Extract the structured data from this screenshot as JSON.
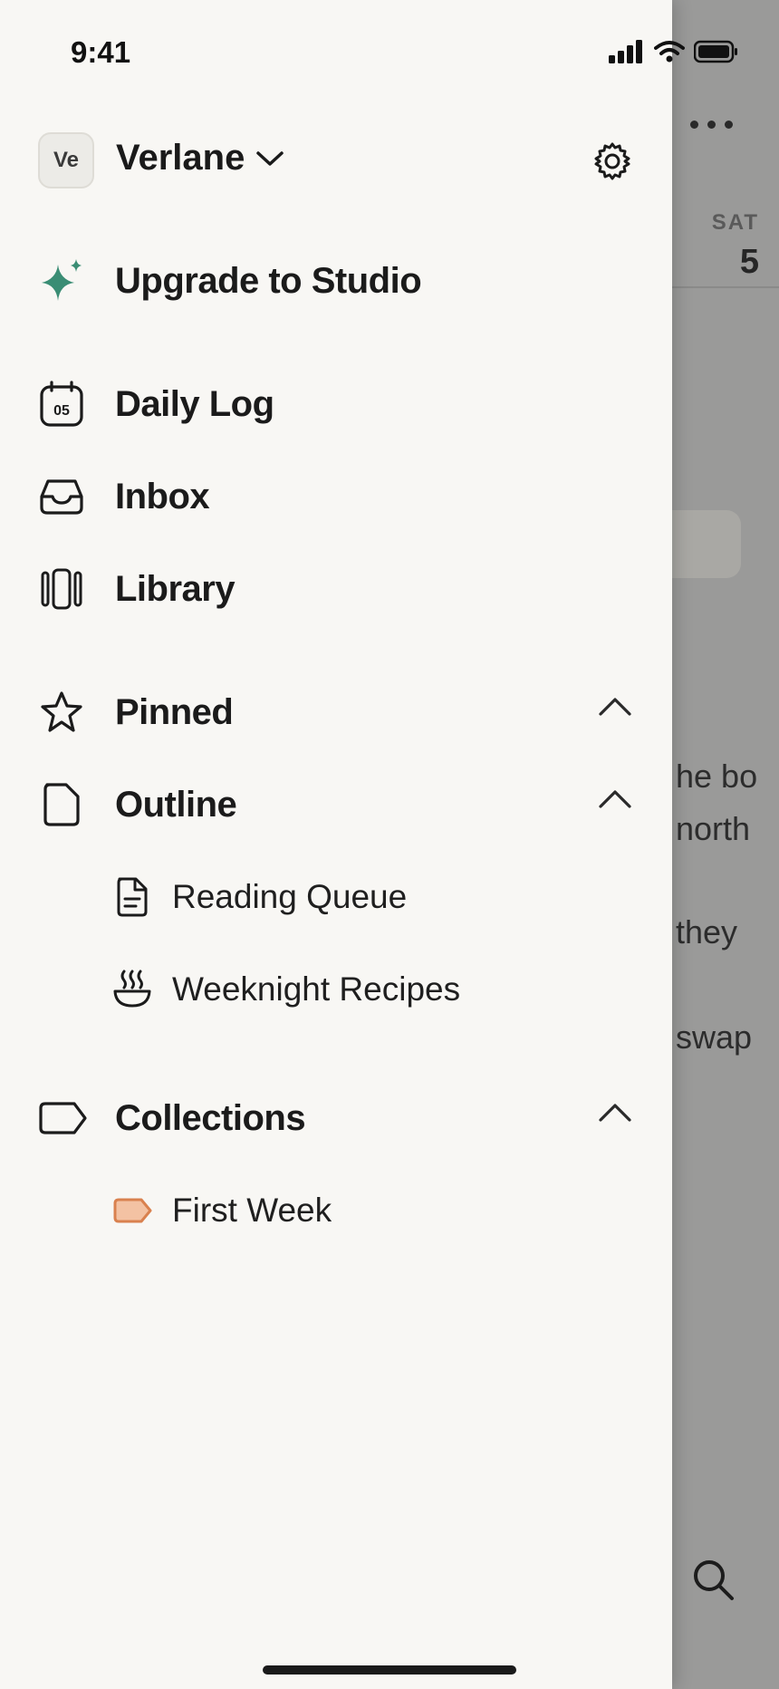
{
  "status_bar": {
    "time": "9:41"
  },
  "workspace": {
    "avatar_initials": "Ve",
    "name": "Verlane"
  },
  "upgrade": {
    "label": "Upgrade to Studio",
    "accent": "#3a8d74"
  },
  "nav": {
    "daily_log": {
      "label": "Daily Log",
      "icon_number": "05"
    },
    "inbox": {
      "label": "Inbox"
    },
    "library": {
      "label": "Library"
    }
  },
  "sections": {
    "pinned": {
      "label": "Pinned"
    },
    "outline": {
      "label": "Outline",
      "items": [
        {
          "label": "Reading Queue",
          "icon": "document-icon"
        },
        {
          "label": "Weeknight Recipes",
          "icon": "bowl-icon"
        }
      ]
    },
    "collections": {
      "label": "Collections",
      "items": [
        {
          "label": "First Week",
          "icon": "tag-icon",
          "color": "#f3c2a3",
          "border": "#d9814f"
        }
      ]
    }
  },
  "background_page": {
    "day_name": "SAT",
    "day_number": "5",
    "text_fragments": [
      "he bo",
      "north",
      "they",
      "swap"
    ]
  }
}
